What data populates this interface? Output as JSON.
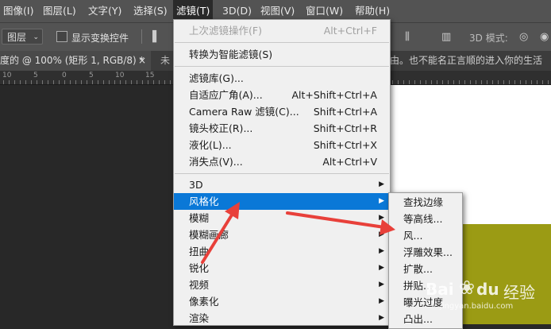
{
  "menubar": {
    "items": [
      {
        "label": "图像(I)"
      },
      {
        "label": "图层(L)"
      },
      {
        "label": "文字(Y)"
      },
      {
        "label": "选择(S)"
      },
      {
        "label": "滤镜(T)"
      },
      {
        "label": "3D(D)"
      },
      {
        "label": "视图(V)"
      },
      {
        "label": "窗口(W)"
      },
      {
        "label": "帮助(H)"
      }
    ]
  },
  "options_bar": {
    "layer_select": "图层",
    "show_transform": "显示变换控件",
    "mode_3d": "3D 模式:"
  },
  "tabs": {
    "doc_tab": "度的 @ 100% (矩形 1, RGB/8) *",
    "close": "×",
    "second_tab": "未",
    "status_text": "由。也不能名正言顺的进入你的生活"
  },
  "ruler": {
    "numbers": [
      "10",
      "5",
      "0",
      "5",
      "10",
      "15"
    ]
  },
  "filter_menu": {
    "last_filter": {
      "label": "上次滤镜操作(F)",
      "shortcut": "Alt+Ctrl+F"
    },
    "convert_smart": {
      "label": "转换为智能滤镜(S)"
    },
    "gallery": {
      "label": "滤镜库(G)..."
    },
    "adaptive_wide": {
      "label": "自适应广角(A)...",
      "shortcut": "Alt+Shift+Ctrl+A"
    },
    "camera_raw": {
      "label": "Camera Raw 滤镜(C)...",
      "shortcut": "Shift+Ctrl+A"
    },
    "lens_correction": {
      "label": "镜头校正(R)...",
      "shortcut": "Shift+Ctrl+R"
    },
    "liquify": {
      "label": "液化(L)...",
      "shortcut": "Shift+Ctrl+X"
    },
    "vanishing_point": {
      "label": "消失点(V)...",
      "shortcut": "Alt+Ctrl+V"
    },
    "submenus": [
      {
        "label": "3D"
      },
      {
        "label": "风格化"
      },
      {
        "label": "模糊"
      },
      {
        "label": "模糊画廊"
      },
      {
        "label": "扭曲"
      },
      {
        "label": "锐化"
      },
      {
        "label": "视频"
      },
      {
        "label": "像素化"
      },
      {
        "label": "渲染"
      }
    ]
  },
  "stylize_submenu": {
    "items": [
      {
        "label": "查找边缘"
      },
      {
        "label": "等高线..."
      },
      {
        "label": "风..."
      },
      {
        "label": "浮雕效果..."
      },
      {
        "label": "扩散..."
      },
      {
        "label": "拼贴..."
      },
      {
        "label": "曝光过度"
      },
      {
        "label": "凸出..."
      }
    ]
  },
  "watermark": {
    "brand": "Bai",
    "brand2": "du",
    "cn": "经验",
    "url": "jingyan.baidu.com"
  },
  "colors": {
    "highlight": "#0a78d7",
    "arrow": "#e8403a",
    "olive": "#9b9b14"
  }
}
